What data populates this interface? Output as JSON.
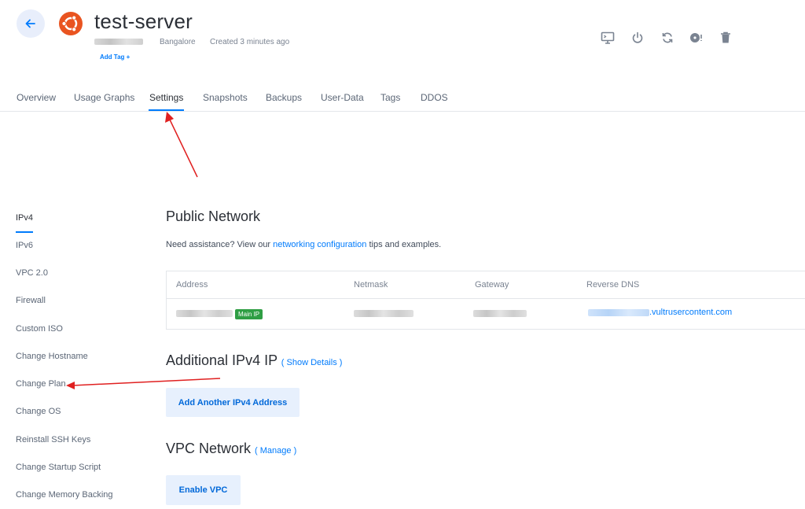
{
  "header": {
    "server_name": "test-server",
    "location": "Bangalore",
    "created": "Created 3 minutes ago",
    "add_tag": "Add Tag +"
  },
  "header_actions": [
    "console-icon",
    "power-icon",
    "restart-icon",
    "iso-icon",
    "trash-icon"
  ],
  "tabs": [
    {
      "label": "Overview"
    },
    {
      "label": "Usage Graphs"
    },
    {
      "label": "Settings",
      "active": true
    },
    {
      "label": "Snapshots"
    },
    {
      "label": "Backups"
    },
    {
      "label": "User-Data"
    },
    {
      "label": "Tags"
    },
    {
      "label": "DDOS"
    }
  ],
  "sidebar": {
    "items": [
      {
        "label": "IPv4",
        "active": true
      },
      {
        "label": "IPv6"
      },
      {
        "label": "VPC 2.0"
      },
      {
        "label": "Firewall"
      },
      {
        "label": "Custom ISO"
      },
      {
        "label": "Change Hostname"
      },
      {
        "label": "Change Plan"
      },
      {
        "label": "Change OS"
      },
      {
        "label": "Reinstall SSH Keys"
      },
      {
        "label": "Change Startup Script"
      },
      {
        "label": "Change Memory Backing"
      }
    ]
  },
  "public_network": {
    "title": "Public Network",
    "assist_prefix": "Need assistance? View our ",
    "assist_link": "networking configuration",
    "assist_suffix": " tips and examples.",
    "columns": [
      "Address",
      "Netmask",
      "Gateway",
      "Reverse DNS"
    ],
    "main_ip_badge": "Main IP",
    "rdns_suffix": ".vultrusercontent.com"
  },
  "additional_ipv4": {
    "title": "Additional IPv4 IP",
    "link": "( Show Details )",
    "button": "Add Another IPv4 Address"
  },
  "vpc_network": {
    "title": "VPC Network",
    "link": "( Manage )",
    "button": "Enable VPC"
  },
  "colors": {
    "accent": "#007bfc",
    "annotation_arrow": "#e02020",
    "badge_green": "#2f9e44",
    "ubuntu_orange": "#e95420"
  }
}
